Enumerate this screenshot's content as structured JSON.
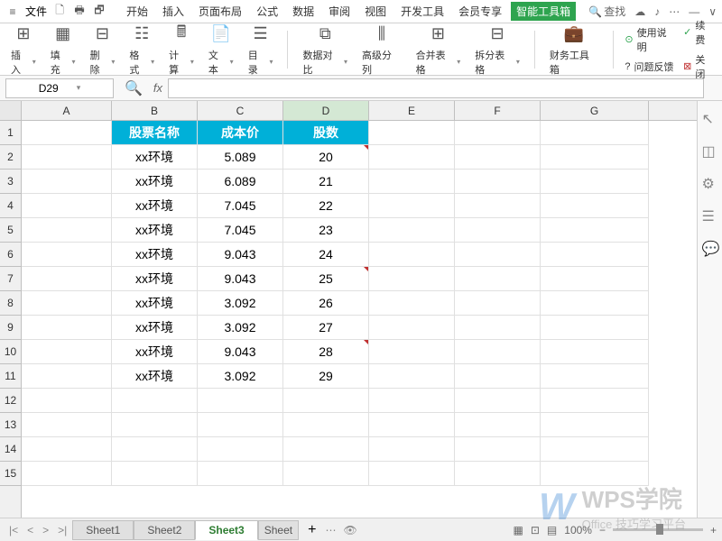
{
  "menubar": {
    "file_label": "文件",
    "tabs": [
      "开始",
      "插入",
      "页面布局",
      "公式",
      "数据",
      "审阅",
      "视图",
      "开发工具",
      "会员专享",
      "智能工具箱"
    ],
    "active_tab_index": 9,
    "search_placeholder": "查找"
  },
  "ribbon": {
    "insert": "插入",
    "fill": "填充",
    "delete": "删除",
    "format": "格式",
    "calc": "计算",
    "text": "文本",
    "toc": "目录",
    "compare": "数据对比",
    "split_col": "高级分列",
    "merge_table": "合并表格",
    "split_table": "拆分表格",
    "finance": "财务工具箱",
    "help": "使用说明",
    "continue": "续费",
    "feedback": "问题反馈",
    "close": "关闭"
  },
  "formula_bar": {
    "name_box": "D29",
    "fx": "fx"
  },
  "columns": [
    "A",
    "B",
    "C",
    "D",
    "E",
    "F",
    "G"
  ],
  "active_col_index": 3,
  "row_count": 15,
  "table": {
    "headers": [
      "股票名称",
      "成本价",
      "股数"
    ],
    "rows": [
      [
        "xx环境",
        "5.089",
        "20"
      ],
      [
        "xx环境",
        "6.089",
        "21"
      ],
      [
        "xx环境",
        "7.045",
        "22"
      ],
      [
        "xx环境",
        "7.045",
        "23"
      ],
      [
        "xx环境",
        "9.043",
        "24"
      ],
      [
        "xx环境",
        "9.043",
        "25"
      ],
      [
        "xx环境",
        "3.092",
        "26"
      ],
      [
        "xx环境",
        "3.092",
        "27"
      ],
      [
        "xx环境",
        "9.043",
        "28"
      ],
      [
        "xx环境",
        "3.092",
        "29"
      ]
    ],
    "markers": [
      0,
      5,
      8
    ]
  },
  "sheet_tabs": {
    "tabs": [
      "Sheet1",
      "Sheet2",
      "Sheet3",
      "Sheet"
    ],
    "active_index": 2,
    "add_label": "+",
    "zoom": "100%"
  },
  "watermark": {
    "title": "WPS学院",
    "subtitle": "Office 技巧学习平台"
  }
}
